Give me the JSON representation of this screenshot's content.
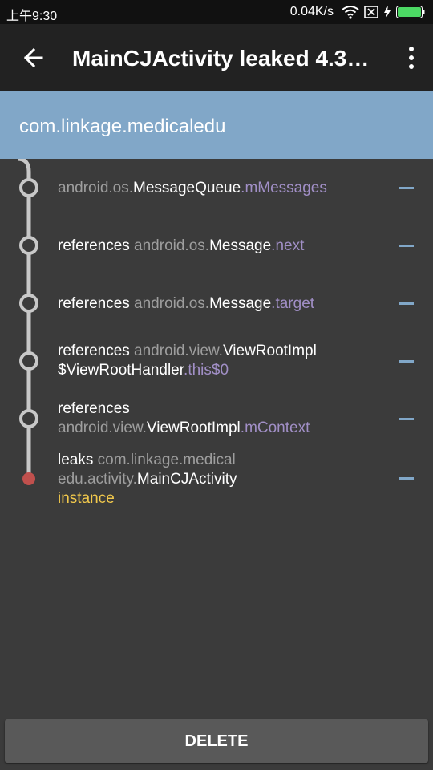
{
  "status_bar": {
    "time": "上午9:30",
    "net_speed": "0.04K/s"
  },
  "app_bar": {
    "title": "MainCJActivity leaked 4.3…",
    "back_icon": "arrow-left-icon",
    "menu_icon": "more-vert-icon"
  },
  "header": {
    "package": "com.linkage.medicaledu"
  },
  "trace": {
    "rows": [
      {
        "prefix": "",
        "pkg": "android.os.",
        "cls": "MessageQueue",
        "dot": ".",
        "field": "mMessages",
        "instance": ""
      },
      {
        "prefix": "references ",
        "pkg": "android.os.",
        "cls": "Message",
        "dot": ".",
        "field": "next",
        "instance": ""
      },
      {
        "prefix": "references ",
        "pkg": "android.os.",
        "cls": "Message",
        "dot": ".",
        "field": "target",
        "instance": ""
      },
      {
        "prefix": "references ",
        "pkg": "android.view.",
        "cls": "ViewRootImpl $ViewRootHandler",
        "dot": ".",
        "field": "this$0",
        "instance": ""
      },
      {
        "prefix": "references ",
        "pkg": "android.view.",
        "cls": "ViewRootImpl",
        "dot": ".",
        "field": "mContext",
        "instance": ""
      },
      {
        "prefix": "leaks ",
        "pkg": "com.linkage.medical edu.activity.",
        "cls": "MainCJActivity",
        "dot": "",
        "field": "",
        "instance": "instance"
      }
    ]
  },
  "colors": {
    "header": "#81a7c8",
    "field": "#a18fc6",
    "instance": "#f2c94c",
    "leak_dot": "#c0504d",
    "node_line": "#c8c8c8"
  },
  "bottom": {
    "delete_label": "DELETE"
  }
}
